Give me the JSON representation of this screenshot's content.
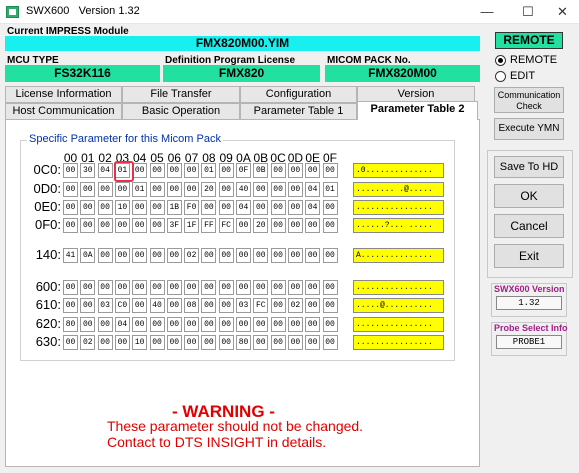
{
  "window": {
    "app_name": "SWX600",
    "version_label": "Version  1.32",
    "min": "—",
    "max": "☐",
    "close": "✕"
  },
  "header": {
    "module_caption": "Current IMPRESS Module",
    "module_value": "FMX820M00.YIM",
    "mcu_caption": "MCU TYPE",
    "mcu_value": "FS32K116",
    "def_caption": "Definition Program License",
    "def_value": "FMX820",
    "micom_caption": "MICOM PACK No.",
    "micom_value": "FMX820M00"
  },
  "tabs_row1": [
    "License Information",
    "File Transfer",
    "Configuration",
    "Version"
  ],
  "tabs_row2": [
    "Host Communication",
    "Basic Operation",
    "Parameter Table 1",
    "Parameter Table 2"
  ],
  "active_tab": "Parameter Table 2",
  "group_label": "Specific Parameter for this Micom Pack",
  "col_headers": [
    "00",
    "01",
    "02",
    "03",
    "04",
    "05",
    "06",
    "07",
    "08",
    "09",
    "0A",
    "0B",
    "0C",
    "0D",
    "0E",
    "0F"
  ],
  "rows": [
    {
      "addr": "0C0:",
      "cells": [
        "00",
        "30",
        "04",
        "01",
        "00",
        "00",
        "00",
        "00",
        "01",
        "00",
        "0F",
        "0B",
        "00",
        "00",
        "00",
        "00"
      ],
      "ascii": ".0.............."
    },
    {
      "addr": "0D0:",
      "cells": [
        "00",
        "00",
        "00",
        "00",
        "01",
        "00",
        "00",
        "00",
        "20",
        "00",
        "40",
        "00",
        "00",
        "00",
        "04",
        "01"
      ],
      "ascii": "........ .@....."
    },
    {
      "addr": "0E0:",
      "cells": [
        "00",
        "00",
        "00",
        "10",
        "00",
        "00",
        "1B",
        "F0",
        "00",
        "00",
        "04",
        "00",
        "00",
        "00",
        "04",
        "00"
      ],
      "ascii": "................"
    },
    {
      "addr": "0F0:",
      "cells": [
        "00",
        "00",
        "00",
        "00",
        "00",
        "00",
        "3F",
        "1F",
        "FF",
        "FC",
        "00",
        "20",
        "00",
        "00",
        "00",
        "00"
      ],
      "ascii": "......?... ....."
    },
    {
      "addr": "140:",
      "cells": [
        "41",
        "0A",
        "00",
        "00",
        "00",
        "00",
        "00",
        "02",
        "00",
        "00",
        "00",
        "00",
        "00",
        "00",
        "00",
        "00"
      ],
      "ascii": "A..............."
    },
    {
      "addr": "600:",
      "cells": [
        "00",
        "00",
        "00",
        "00",
        "00",
        "00",
        "00",
        "00",
        "00",
        "00",
        "00",
        "00",
        "00",
        "00",
        "00",
        "00"
      ],
      "ascii": "................"
    },
    {
      "addr": "610:",
      "cells": [
        "00",
        "00",
        "03",
        "C0",
        "00",
        "40",
        "00",
        "08",
        "00",
        "00",
        "03",
        "FC",
        "00",
        "02",
        "00",
        "00"
      ],
      "ascii": ".....@.........."
    },
    {
      "addr": "620:",
      "cells": [
        "80",
        "00",
        "00",
        "04",
        "00",
        "00",
        "00",
        "00",
        "00",
        "00",
        "00",
        "00",
        "00",
        "00",
        "00",
        "00"
      ],
      "ascii": "................"
    },
    {
      "addr": "630:",
      "cells": [
        "00",
        "02",
        "00",
        "00",
        "10",
        "00",
        "00",
        "00",
        "00",
        "00",
        "80",
        "00",
        "00",
        "00",
        "00",
        "00"
      ],
      "ascii": "................"
    }
  ],
  "warning": {
    "title": "- WARNING -",
    "line1": "These parameter should not be changed.",
    "line2": "Contact to DTS INSIGHT in details."
  },
  "right": {
    "remote_label": "REMOTE",
    "radio_remote": "REMOTE",
    "radio_edit": "EDIT",
    "comm_check": [
      "Communication",
      "Check"
    ],
    "execute": "Execute YMN",
    "save": "Save To HD",
    "ok": "OK",
    "cancel": "Cancel",
    "exit": "Exit",
    "version_label": "SWX600 Version",
    "version_value": "1.32",
    "probe_label": "Probe Select Info",
    "probe_value": "PROBE1"
  },
  "colors": {
    "cyan": "#18f0f0",
    "green": "#22e0a0",
    "ascii_bg": "#ffff00",
    "warning": "#e00000",
    "marker": "#e8304a"
  }
}
